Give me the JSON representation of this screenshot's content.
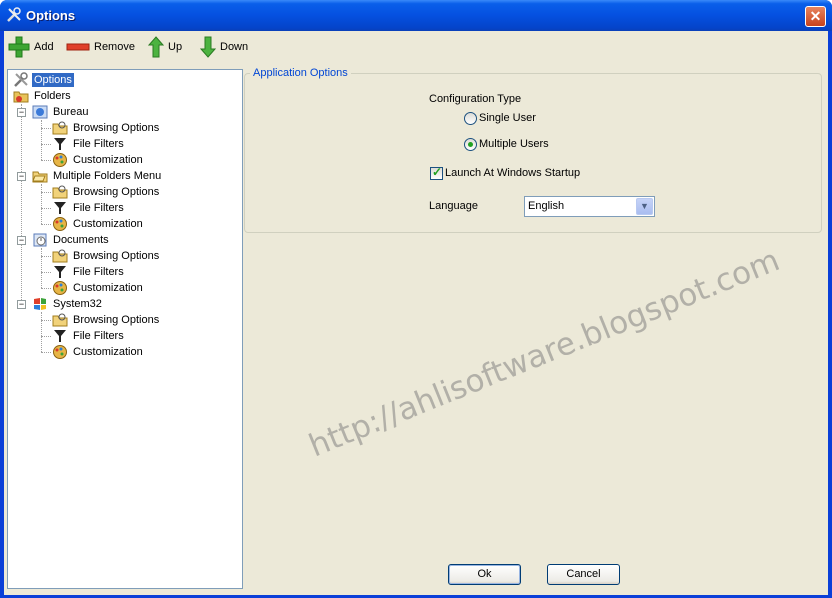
{
  "window": {
    "title": "Options",
    "close_glyph": "✕"
  },
  "toolbar": {
    "add_label": "Add",
    "remove_label": "Remove",
    "up_label": "Up",
    "down_label": "Down"
  },
  "tree": {
    "options_label": "Options",
    "folders_label": "Folders",
    "nodes": [
      {
        "label": "Bureau",
        "children": [
          "Browsing Options",
          "File Filters",
          "Customization"
        ]
      },
      {
        "label": "Multiple Folders Menu",
        "children": [
          "Browsing Options",
          "File Filters",
          "Customization"
        ]
      },
      {
        "label": "Documents",
        "children": [
          "Browsing Options",
          "File Filters",
          "Customization"
        ]
      },
      {
        "label": "System32",
        "children": [
          "Browsing Options",
          "File Filters",
          "Customization"
        ]
      }
    ]
  },
  "app_options": {
    "group_title": "Application Options",
    "config_type_label": "Configuration Type",
    "single_user_label": "Single User",
    "multiple_users_label": "Multiple Users",
    "selected": "Multiple Users",
    "launch_label": "Launch At Windows Startup",
    "launch_checked": true,
    "language_label": "Language",
    "language_value": "English"
  },
  "buttons": {
    "ok_label": "Ok",
    "cancel_label": "Cancel"
  },
  "watermark": "http://ahlisoftware.blogspot.com"
}
